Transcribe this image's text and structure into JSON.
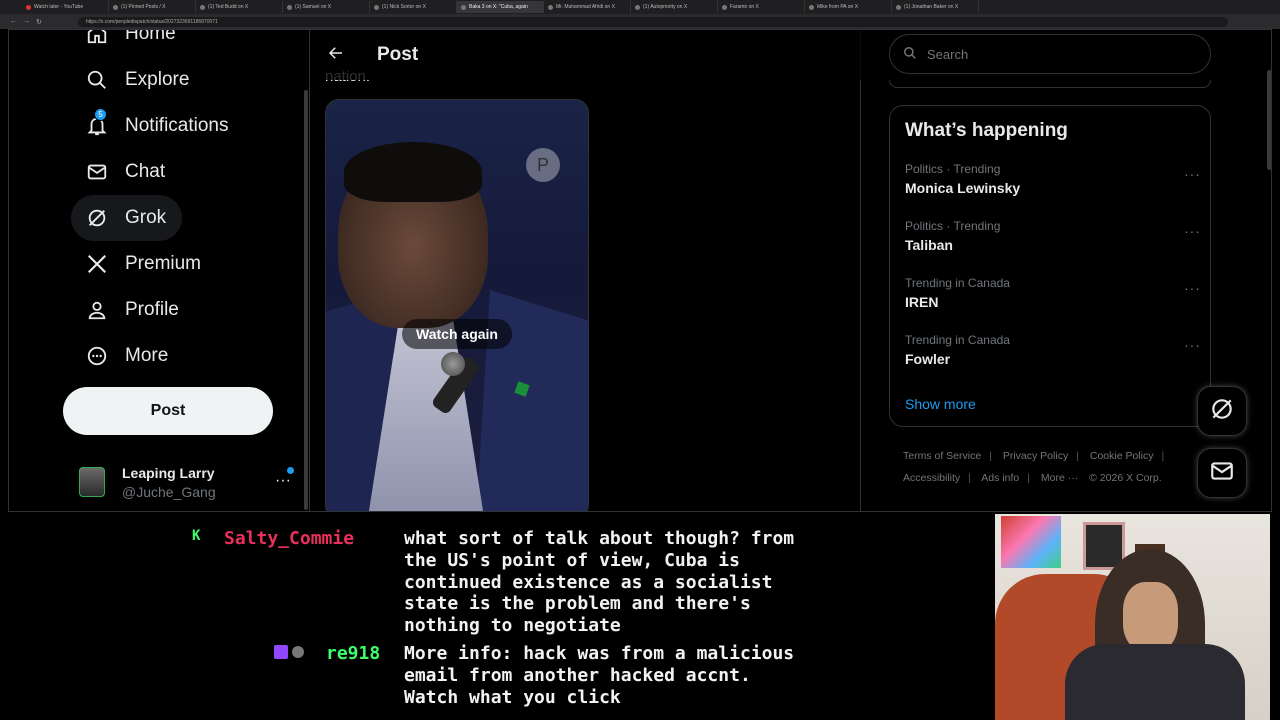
{
  "browser": {
    "tabs": [
      {
        "label": "Watch later - YouTube",
        "active": false
      },
      {
        "label": "(1) Pinned Posts / X",
        "active": false
      },
      {
        "label": "(1) Ted Budd on X",
        "active": false
      },
      {
        "label": "(1) Samuel on X",
        "active": false
      },
      {
        "label": "(1) Nick Sortor on X",
        "active": false
      },
      {
        "label": "Baka 3 on X: \"Cuba, again",
        "active": true
      },
      {
        "label": "Mr. Muhammad Afridi on X",
        "active": false
      },
      {
        "label": "(1) Autopriority on X",
        "active": false
      },
      {
        "label": "Faramir on X",
        "active": false
      },
      {
        "label": "Mike from PA on X",
        "active": false
      },
      {
        "label": "(1) Jonathan Baker on X",
        "active": false
      }
    ],
    "url": "https://x.com/peopledispatch/status/2027323691186870071"
  },
  "nav": {
    "items": [
      {
        "label": "Home",
        "icon": "home-icon"
      },
      {
        "label": "Explore",
        "icon": "search-icon"
      },
      {
        "label": "Notifications",
        "icon": "bell-icon",
        "badge": "5"
      },
      {
        "label": "Chat",
        "icon": "mail-icon"
      },
      {
        "label": "Grok",
        "icon": "grok-icon"
      },
      {
        "label": "Premium",
        "icon": "x-logo-icon"
      },
      {
        "label": "Profile",
        "icon": "person-icon"
      },
      {
        "label": "More",
        "icon": "more-circle-icon"
      }
    ],
    "post_label": "Post",
    "account": {
      "name": "Leaping Larry",
      "handle": "@Juche_Gang"
    }
  },
  "post_view": {
    "title": "Post",
    "text_snippet": "nation.",
    "video": {
      "overlay_label": "Watch again",
      "watermark": "P"
    }
  },
  "sidebar": {
    "search_placeholder": "Search",
    "whats_happening": "What’s happening",
    "trends": [
      {
        "meta": "Politics · Trending",
        "name": "Monica Lewinsky"
      },
      {
        "meta": "Politics · Trending",
        "name": "Taliban"
      },
      {
        "meta": "Trending in Canada",
        "name": "IREN"
      },
      {
        "meta": "Trending in Canada",
        "name": "Fowler"
      }
    ],
    "show_more": "Show more",
    "footer": {
      "terms": "Terms of Service",
      "privacy": "Privacy Policy",
      "cookie": "Cookie Policy",
      "accessibility": "Accessibility",
      "ads": "Ads info",
      "more": "More ···",
      "copyright": "© 2026 X Corp."
    }
  },
  "stream_chat": {
    "messages": [
      {
        "user": "Salty_Commie",
        "badge": "K",
        "lines": [
          "what sort of talk about though? from",
          "the US's point of view, Cuba is",
          "continued existence as a socialist",
          "state is the problem and there's",
          "nothing to negotiate"
        ]
      },
      {
        "user": "re918",
        "lines": [
          "More info: hack was from a malicious",
          "email from another hacked accnt.",
          "Watch what you click"
        ]
      }
    ]
  }
}
